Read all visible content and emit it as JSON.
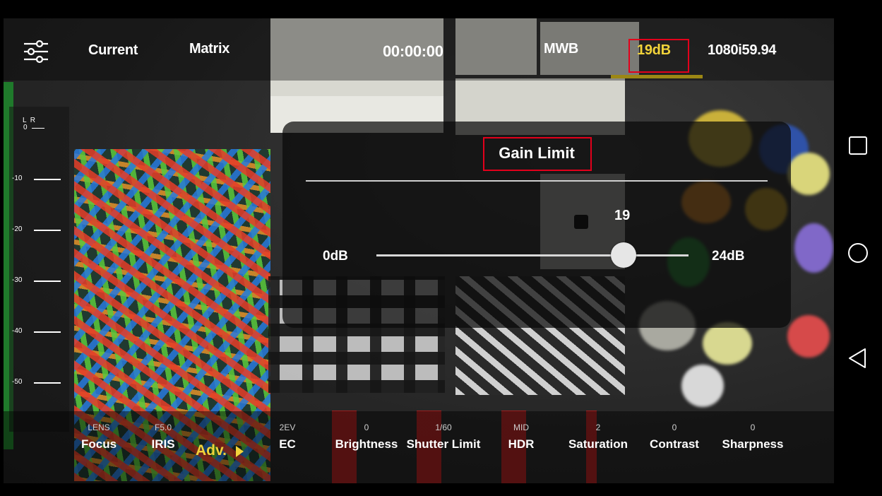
{
  "topbar": {
    "mode": "Current",
    "matrix": "Matrix",
    "timecode": "00:00:00",
    "white_balance": "MWB",
    "gain": "19dB",
    "format": "1080i59.94"
  },
  "audio_meter": {
    "lr_label": "L  R",
    "levels": [
      "0",
      "-10",
      "-20",
      "-30",
      "-40",
      "-50"
    ]
  },
  "dialog": {
    "title": "Gain Limit",
    "value": "19",
    "min_label": "0dB",
    "max_label": "24dB",
    "slider": {
      "min": 0,
      "max": 24,
      "value": 19
    }
  },
  "bottombar": {
    "focus": {
      "top": "LENS",
      "label": "Focus"
    },
    "iris": {
      "top": "F5.0",
      "label": "IRIS"
    },
    "adv": {
      "label": "Adv."
    },
    "ec": {
      "top": "2EV",
      "label": "EC"
    },
    "brightness": {
      "top": "0",
      "label": "Brightness"
    },
    "shutter_limit": {
      "top": "1/60",
      "label": "Shutter Limit"
    },
    "hdr": {
      "top": "MID",
      "label": "HDR"
    },
    "saturation": {
      "top": "2",
      "label": "Saturation"
    },
    "contrast": {
      "top": "0",
      "label": "Contrast"
    },
    "sharpness": {
      "top": "0",
      "label": "Sharpness"
    }
  },
  "colors": {
    "accent_yellow": "#f2d33a",
    "highlight_red": "#e3001b"
  },
  "icons": {
    "settings": "settings-sliders-icon",
    "recents": "square-recents-icon",
    "home": "circle-home-icon",
    "back": "triangle-back-icon"
  }
}
